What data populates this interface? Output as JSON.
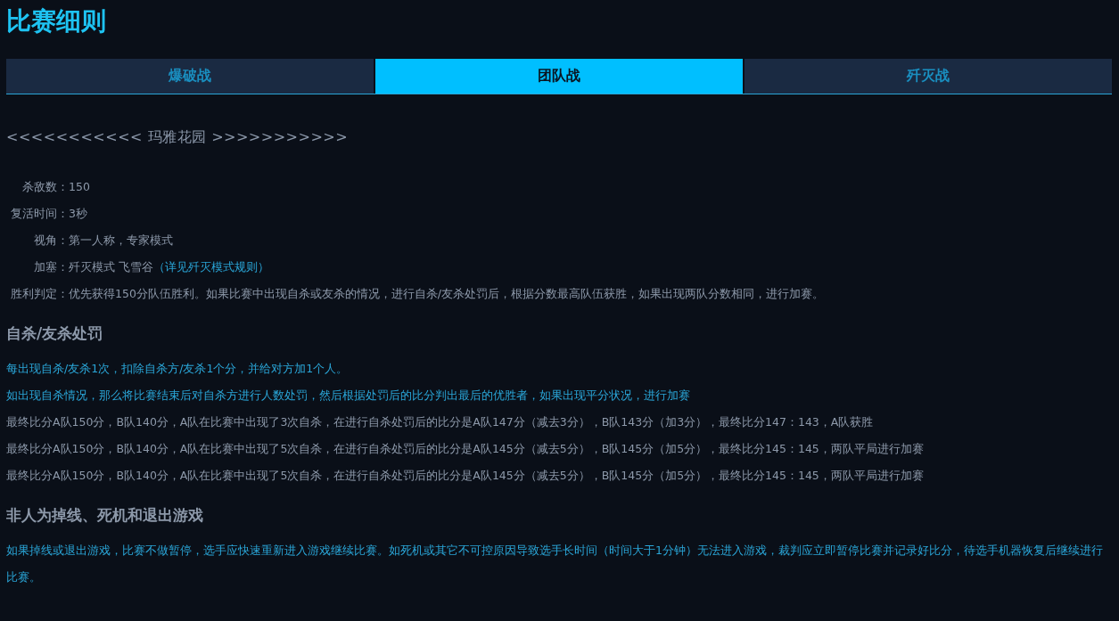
{
  "title": "比赛细则",
  "tabs": [
    {
      "label": "爆破战",
      "selected": false
    },
    {
      "label": "团队战",
      "selected": true
    },
    {
      "label": "歼灭战",
      "selected": false
    }
  ],
  "map_heading": "<<<<<<<<<<< 玛雅花园 >>>>>>>>>>>",
  "settings": [
    {
      "label": "杀敌数：",
      "value": "150"
    },
    {
      "label": "复活时间：",
      "value": "3秒"
    },
    {
      "label": "视角：",
      "value": "第一人称，专家模式"
    },
    {
      "label": "加塞：",
      "value": "歼灭模式 飞雪谷",
      "link": "（详见歼灭模式规则）"
    },
    {
      "label": "胜利判定：",
      "value": "优先获得150分队伍胜利。如果比赛中出现自杀或友杀的情况，进行自杀/友杀处罚后，根据分数最高队伍获胜，如果出现两队分数相同，进行加赛。"
    }
  ],
  "sections": [
    {
      "title": "自杀/友杀处罚",
      "paragraphs": [
        {
          "kind": "highlight",
          "text": "每出现自杀/友杀1次，扣除自杀方/友杀1个分，并给对方加1个人。"
        },
        {
          "kind": "highlight",
          "text": "如出现自杀情况，那么将比赛结束后对自杀方进行人数处罚，然后根据处罚后的比分判出最后的优胜者，如果出现平分状况，进行加赛"
        },
        {
          "kind": "plain",
          "text": "最终比分A队150分，B队140分，A队在比赛中出现了3次自杀，在进行自杀处罚后的比分是A队147分（减去3分），B队143分（加3分），最终比分147：143，A队获胜"
        },
        {
          "kind": "plain",
          "text": "最终比分A队150分，B队140分，A队在比赛中出现了5次自杀，在进行自杀处罚后的比分是A队145分（减去5分），B队145分（加5分），最终比分145：145，两队平局进行加赛"
        },
        {
          "kind": "plain",
          "text": "最终比分A队150分，B队140分，A队在比赛中出现了5次自杀，在进行自杀处罚后的比分是A队145分（减去5分），B队145分（加5分），最终比分145：145，两队平局进行加赛"
        }
      ]
    },
    {
      "title": "非人为掉线、死机和退出游戏",
      "paragraphs": [
        {
          "kind": "highlight",
          "text": "如果掉线或退出游戏，比赛不做暂停，选手应快速重新进入游戏继续比赛。如死机或其它不可控原因导致选手长时间（时间大于1分钟）无法进入游戏，裁判应立即暂停比赛并记录好比分，待选手机器恢复后继续进行比赛。"
        }
      ]
    }
  ]
}
